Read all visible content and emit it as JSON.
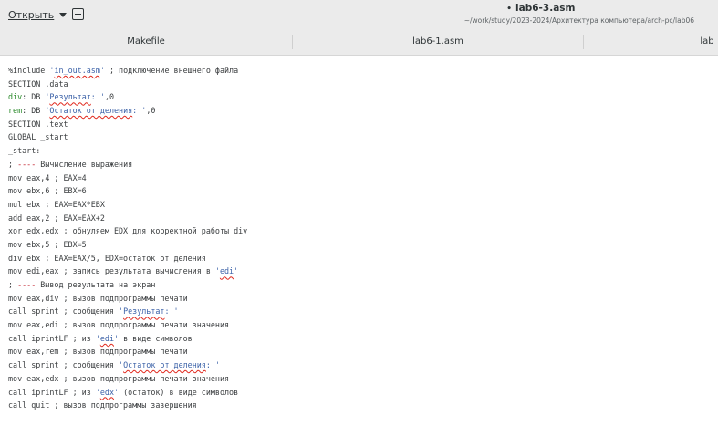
{
  "header": {
    "open_label": "Открыть",
    "title": "lab6-3.asm",
    "modified_dot": "•",
    "path": "~/work/study/2023-2024/Архитектура компьютера/arch-pc/lab06"
  },
  "tabs": [
    {
      "label": "Makefile"
    },
    {
      "label": "lab6-1.asm"
    },
    {
      "label": "lab"
    }
  ],
  "code_lines": [
    "%include 'in_out.asm' ; подключение внешнего файла",
    "SECTION .data",
    "div: DB 'Результат: ',0",
    "rem: DB 'Остаток от деления: ',0",
    "SECTION .text",
    "GLOBAL _start",
    "_start:",
    "; ---- Вычисление выражения",
    "mov eax,4 ; EAX=4",
    "mov ebx,6 ; EBX=6",
    "mul ebx ; EAX=EAX*EBX",
    "add eax,2 ; EAX=EAX+2",
    "xor edx,edx ; обнуляем EDX для корректной работы div",
    "mov ebx,5 ; EBX=5",
    "div ebx ; EAX=EAX/5, EDX=остаток от деления",
    "mov edi,eax ; запись результата вычисления в 'edi'",
    "; ---- Вывод результата на экран",
    "mov eax,div ; вызов подпрограммы печати",
    "call sprint ; сообщения 'Результат: '",
    "mov eax,edi ; вызов подпрограммы печати значения",
    "call iprintLF ; из 'edi' в виде символов",
    "mov eax,rem ; вызов подпрограммы печати",
    "call sprint ; сообщения 'Остаток от деления: '",
    "mov eax,edx ; вызов подпрограммы печати значения",
    "call iprintLF ; из 'edx' (остаток) в виде символов",
    "call quit ; вызов подпрограммы завершения"
  ],
  "colors": {
    "header_bg": "#ebebeb",
    "editor_bg": "#ffffff",
    "label": "#2a8a2a",
    "string": "#3c62a8",
    "spell_underline": "#e0271c"
  }
}
